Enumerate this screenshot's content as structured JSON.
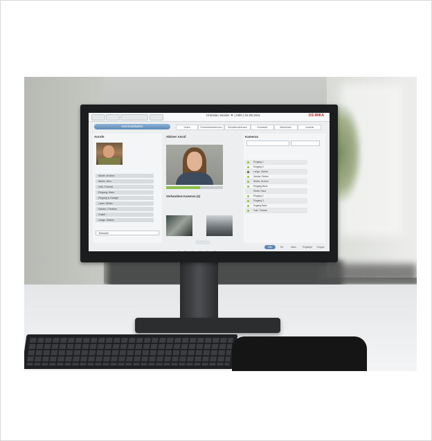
{
  "screen_ui": {
    "user_info": "Christian Sander ▼ | Hilfe | 02.08.2011",
    "brand": "DS-WIKA",
    "tabs": [
      "Kommunikation",
      "Video",
      "Schnellaufnahmen",
      "Schaltfunktionen",
      "Kontakte",
      "Betriebsb.",
      "Journal"
    ],
    "left_title": "Anrufe",
    "center_title": "Aktiver Anruf",
    "cams_title": "Vorhandene Kameras (4)",
    "right_title": "Kameras",
    "calls": [
      "Winter, Andrea",
      "Winter, Nico",
      "Volk, Thomas",
      "Eingang, Haus",
      "Eingang & Garage",
      "Lader, Stefan",
      "Sander, Christian",
      "Gustel",
      "Lange, Sabine"
    ],
    "table_rows": [
      "Eingang 1",
      "Eingang 2",
      "Lange, Sabine",
      "Sander, Stefan",
      "Winter, Andrea",
      "Eingang Back",
      "Winter Haus",
      "Eingang 1",
      "Eingang 3",
      "Zugang Back",
      "Volk, Thomas"
    ],
    "bottom_tabs": [
      "Alle",
      "Ort",
      "Intern",
      "Eingänge",
      "Gruppe"
    ],
    "footer_dropdown": "Bedarafe"
  },
  "colors": {
    "accent": "#5f88b2",
    "brand": "#c8202a",
    "status_green": "#8bc34a"
  }
}
